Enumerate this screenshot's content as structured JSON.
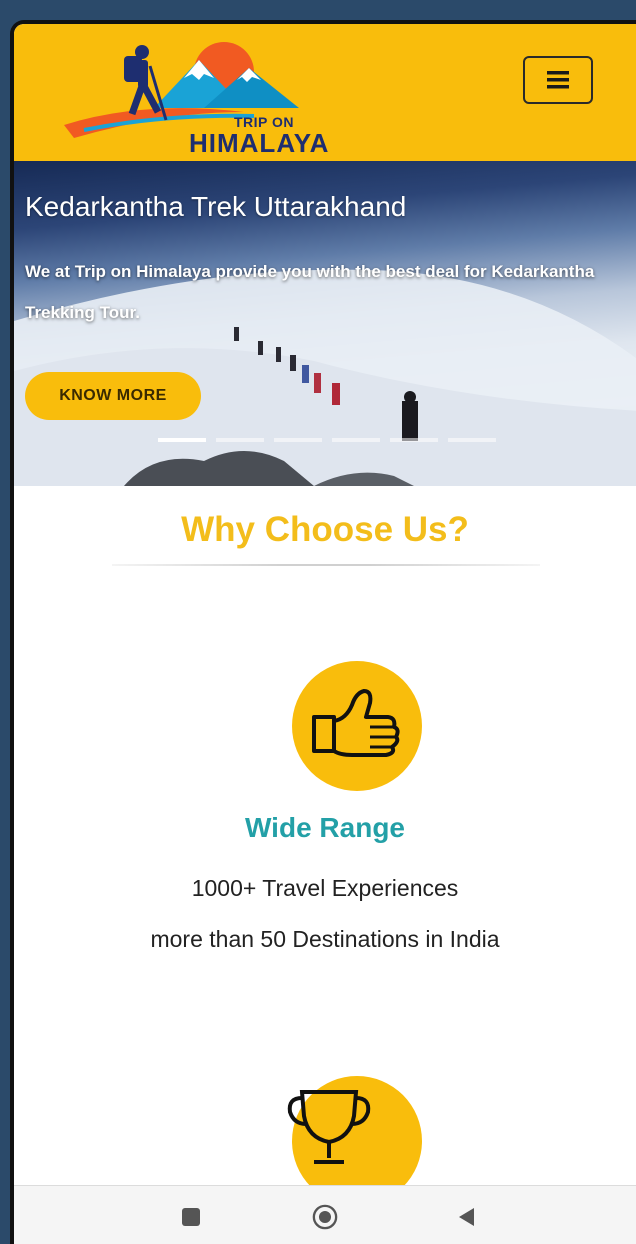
{
  "header": {
    "logo_small": "TRIP ON",
    "logo_big": "HIMALAYA",
    "menu_icon": "hamburger-icon"
  },
  "hero": {
    "title": "Kedarkantha Trek Uttarakhand",
    "description": "We at Trip on Himalaya provide you with the best deal for Kedarkantha Trekking Tour.",
    "button_label": "KNOW MORE",
    "slide_count": 6,
    "active_slide": 1
  },
  "section": {
    "title": "Why Choose Us?"
  },
  "features": [
    {
      "icon": "thumbs-up-icon",
      "title": "Wide Range",
      "line1": "1000+ Travel Experiences",
      "line2": "more than 50 Destinations in India"
    },
    {
      "icon": "trophy-icon"
    }
  ],
  "navbar": {
    "icons": [
      "recent-apps-icon",
      "home-icon",
      "back-icon"
    ]
  },
  "colors": {
    "brand_yellow": "#f9bd0c",
    "accent_teal": "#23a0a7",
    "logo_navy": "#1e2e70",
    "frame_blue": "#2b4a6a"
  }
}
